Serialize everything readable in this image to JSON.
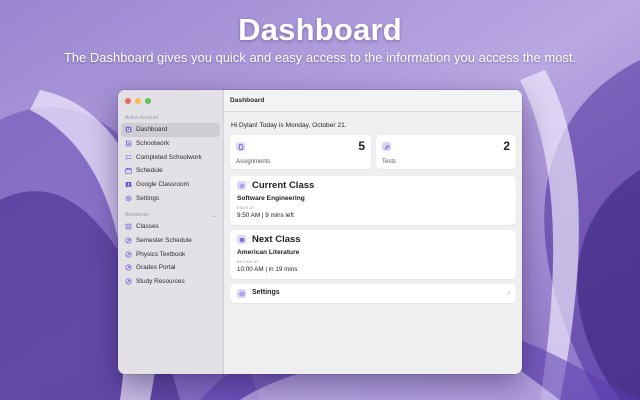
{
  "hero": {
    "title": "Dashboard",
    "subtitle": "The Dashboard gives you quick and easy access to the information you access the most."
  },
  "window": {
    "title": "Dashboard",
    "sidebar": {
      "section_actions": "Action Account",
      "items": [
        {
          "label": "Dashboard",
          "icon": "dashboard-icon",
          "active": true
        },
        {
          "label": "Schoolwork",
          "icon": "schoolwork-icon"
        },
        {
          "label": "Completed Schoolwork",
          "icon": "checklist-icon"
        },
        {
          "label": "Schedule",
          "icon": "calendar-icon"
        },
        {
          "label": "Google Classroom",
          "icon": "classroom-icon"
        },
        {
          "label": "Settings",
          "icon": "gear-icon"
        }
      ],
      "section_resources": "Resources",
      "resources": [
        {
          "label": "Classes",
          "icon": "list-icon"
        },
        {
          "label": "Semester Schedule",
          "icon": "link-icon"
        },
        {
          "label": "Physics Textbook",
          "icon": "link-icon"
        },
        {
          "label": "Grades Portal",
          "icon": "link-icon"
        },
        {
          "label": "Study Resources",
          "icon": "link-icon"
        }
      ]
    },
    "greeting": "Hi Dylan! Today is Monday, October 21.",
    "stats": [
      {
        "label": "Assignments",
        "value": "5",
        "icon": "document-icon"
      },
      {
        "label": "Tests",
        "value": "2",
        "icon": "pencil-icon"
      }
    ],
    "current_class": {
      "title": "Current Class",
      "name": "Software Engineering",
      "small_label": "ENDS AT",
      "time": "9:50 AM | 9 mins left",
      "icon": "swap-icon"
    },
    "next_class": {
      "title": "Next Class",
      "name": "American Literature",
      "small_label": "BEGINS AT",
      "time": "10:00 AM | in 19 mins",
      "icon": "next-icon"
    },
    "settings_row": {
      "label": "Settings",
      "icon": "gear-icon"
    },
    "accent": "#5b4fd6"
  }
}
